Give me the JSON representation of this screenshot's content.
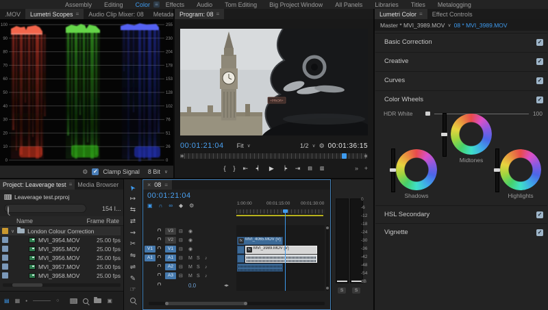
{
  "colors": {
    "accent_blue": "#3e9bef",
    "timecode_blue": "#4aa0f0",
    "track_button_blue": "#4579ad",
    "work_area_yellow": "#b9b31c",
    "checkbox_fill": "#9fb6c9",
    "clamp_checkbox_blue": "#4a7eb8",
    "clip_blue": "#3c6a97",
    "selected_clip": "#d6d6d6",
    "panel_bg": "#232323",
    "scope_red": "#ff4530",
    "scope_green": "#45d428",
    "scope_blue": "#3346ff"
  },
  "icons": {
    "panel_menu": "≡",
    "chevron_down": "∨",
    "overflow": "»",
    "close": "×",
    "check": "✓",
    "wrench": "⚙",
    "magnet": "∩",
    "linked_selection": "∞",
    "marker": "◆",
    "nest": "▣",
    "eye": "◉",
    "patch": "⊟",
    "mic": "♪",
    "mark_in": "{",
    "mark_out": "}",
    "go_to_in": "⇤",
    "step_back": "◂▏",
    "play": "▶",
    "step_forward": "▕▸",
    "go_to_out": "⇥",
    "lift": "▤",
    "extract": "▥",
    "plus": "+",
    "fit_arrows": "◂▸",
    "selection_tool": "➤",
    "track_select_tool": "↦",
    "ripple_tool": "⇆",
    "rolling_tool": "⇄",
    "rate_stretch_tool": "⇝",
    "razor_tool": "✂",
    "slip_tool": "⇋",
    "slide_tool": "⇌",
    "pen_tool": "✎",
    "hand_tool": "☞",
    "list_view": "▤",
    "icon_view": "▦",
    "zoom_out_dot": "●",
    "zoom_in_ring": "○",
    "new_item": "▣",
    "disclosure": "∨"
  },
  "workspace": {
    "items": [
      "Assembly",
      "Editing",
      "Color",
      "Effects",
      "Audio",
      "Tom Editing",
      "Big Project Window",
      "All Panels",
      "Libraries",
      "Titles",
      "Metalogging"
    ]
  },
  "panel_tabs": {
    "left_stub": ".MOV",
    "scopes": "Lumetri Scopes",
    "mixer": "Audio Clip Mixer: 08",
    "metadata": "Metadata",
    "program": "Program: 08",
    "lumetri": "Lumetri Color",
    "effect_controls": "Effect Controls"
  },
  "scopes": {
    "left_scale": [
      "100",
      "90",
      "80",
      "70",
      "60",
      "50",
      "40",
      "30",
      "20",
      "10",
      "0"
    ],
    "right_scale": [
      "255",
      "230",
      "204",
      "178",
      "153",
      "128",
      "102",
      "76",
      "51",
      "26",
      "0"
    ],
    "clamp_label": "Clamp Signal",
    "bit_depth": "8 Bit"
  },
  "program": {
    "current_time": "00:01:21:04",
    "fit": "Fit",
    "resolution": "1/2",
    "duration": "00:01:36:15",
    "plaque_text": "+PRIOR+"
  },
  "lumetri": {
    "master_clip": "Master * MVI_3989.MOV",
    "sequence_clip": "08 * MVI_3989.MOV",
    "sections": [
      "Basic Correction",
      "Creative",
      "Curves",
      "Color Wheels"
    ],
    "hdr_label": "HDR White",
    "hdr_max": "100",
    "wheel_labels": [
      "Shadows",
      "Midtones",
      "Highlights"
    ],
    "bottom_sections": [
      "HSL Secondary",
      "Vignette"
    ]
  },
  "project": {
    "tab": "Project: Leaverage test",
    "media_browser": "Media Browser",
    "filename": "Leaverage test.prproj",
    "item_count": "154 I...",
    "col_name": "Name",
    "col_frame_rate": "Frame Rate",
    "bin_name": "London Colour Correction",
    "rows": [
      {
        "name": "MVI_3954.MOV",
        "fps": "25.00 fps"
      },
      {
        "name": "MVI_3955.MOV",
        "fps": "25.00 fps"
      },
      {
        "name": "MVI_3956.MOV",
        "fps": "25.00 fps"
      },
      {
        "name": "MVI_3957.MOV",
        "fps": "25.00 fps"
      },
      {
        "name": "MVI_3958.MOV",
        "fps": "25.00 fps"
      }
    ]
  },
  "timeline": {
    "tab": "08",
    "timecode": "00:01:21:04",
    "ruler_labels": [
      "1:00:00",
      "00:01:15:00",
      "00:01:30:00"
    ],
    "tracks_video": [
      "V3",
      "V2",
      "V1"
    ],
    "tracks_audio": [
      "A1",
      "A2",
      "A3"
    ],
    "source_video": "V1",
    "source_audio": "A1",
    "mute": "M",
    "solo": "S",
    "clip_v2": "MVI_4065.MOV [V]",
    "clip_v1": "MVI_3989.MOV [V]",
    "fx": "fx",
    "master_level": "0.0"
  },
  "meters": {
    "scale": [
      "0",
      "-6",
      "-12",
      "-18",
      "-24",
      "-30",
      "-36",
      "-42",
      "-48",
      "-54",
      "dB"
    ],
    "solo": "S"
  }
}
